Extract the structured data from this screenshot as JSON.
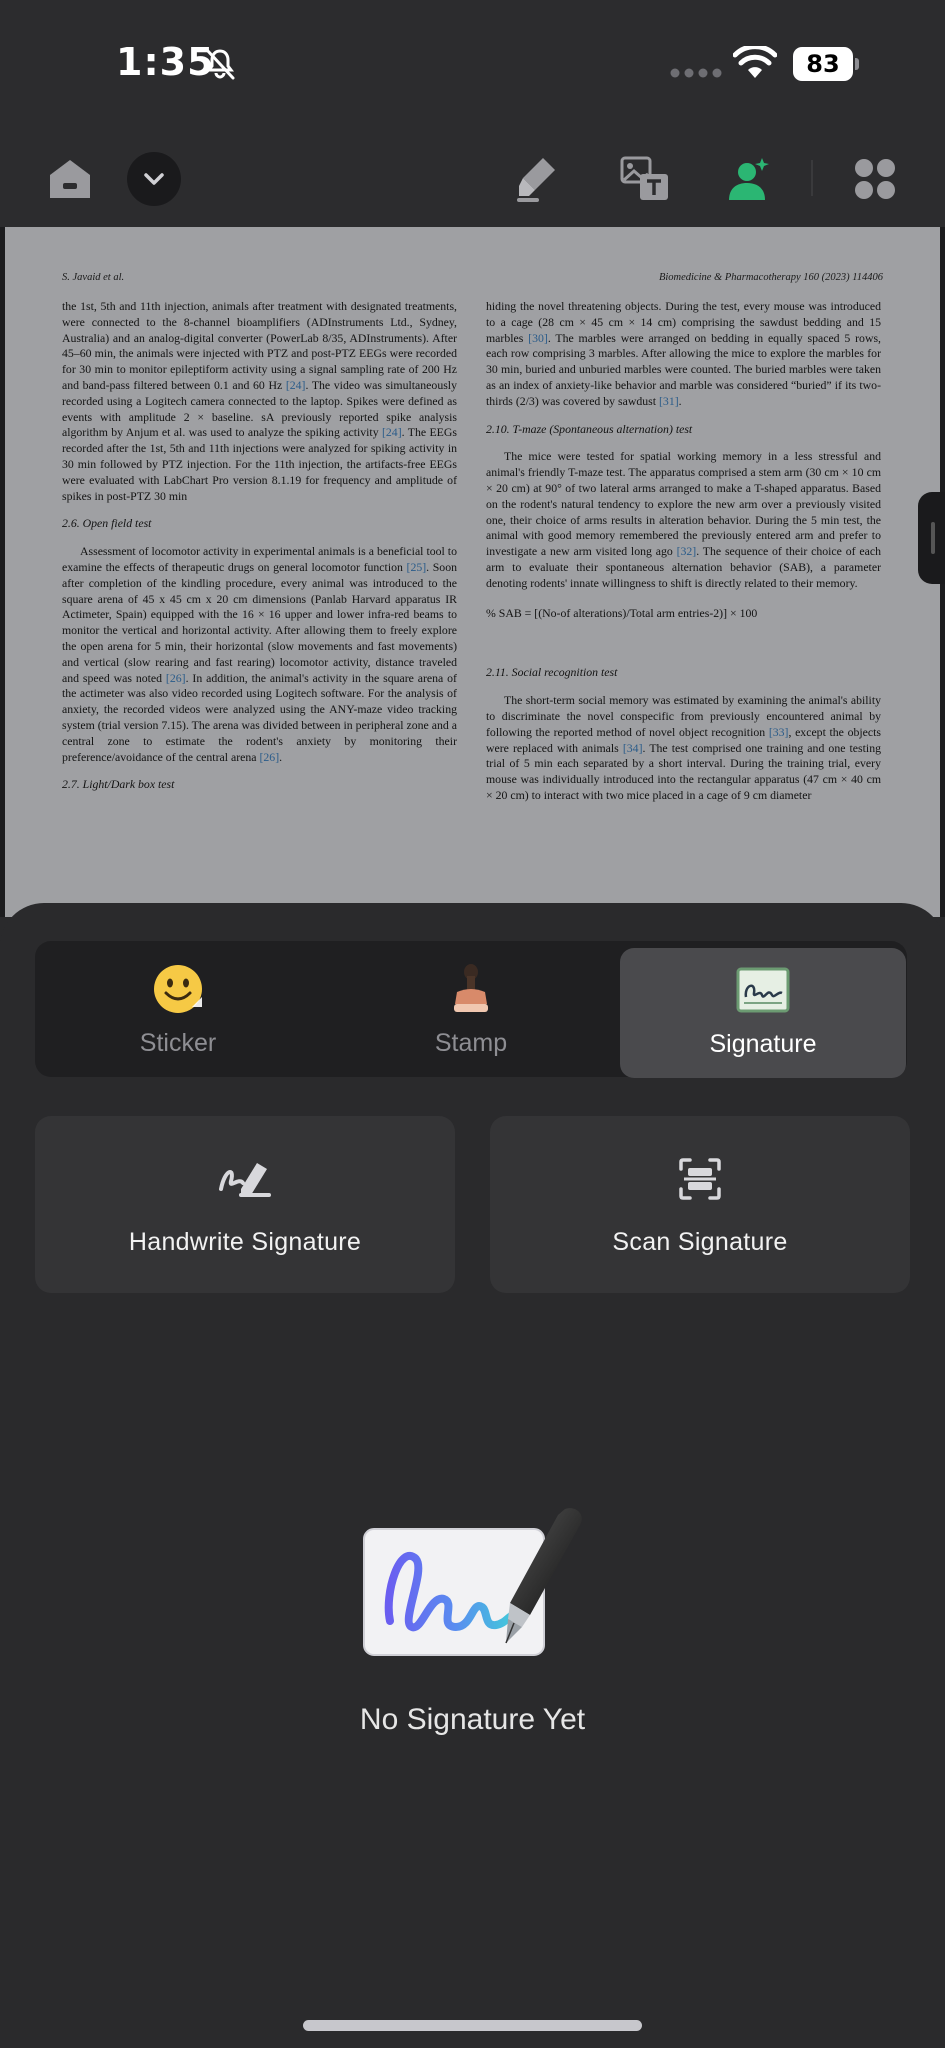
{
  "status_bar": {
    "time": "1:35",
    "battery": "83",
    "icons": [
      "bell-slash-icon",
      "cellular-dots-icon",
      "wifi-icon",
      "battery-icon"
    ]
  },
  "toolbar": {
    "icons": [
      "home-icon",
      "chevron-down-icon",
      "highlighter-icon",
      "image-text-icon",
      "person-add-icon",
      "grid-icon"
    ],
    "accent": "#2bb673"
  },
  "document": {
    "header_left": "S. Javaid et al.",
    "header_right": "Biomedicine & Pharmacotherapy 160 (2023) 114406",
    "left_col": {
      "p1": "the 1st, 5th and 11th injection, animals after treatment with designated treatments, were connected to the 8-channel bioamplifiers (ADInstruments Ltd., Sydney, Australia) and an analog-digital converter (PowerLab 8/35, ADInstruments). After 45–60 min, the animals were injected with PTZ and post-PTZ EEGs were recorded for 30 min to monitor epileptiform activity using a signal sampling rate of 200 Hz and band-pass filtered between 0.1 and 60 Hz ",
      "p1_ref1": "[24]",
      "p1b": ". The video was simultaneously recorded using a Logitech camera connected to the laptop. Spikes were defined as events with amplitude 2 × baseline. sA previously reported spike analysis algorithm by Anjum et al. was used to analyze the spiking activity ",
      "p1_ref2": "[24]",
      "p1c": ". The EEGs recorded after the 1st, 5th and 11th injections were analyzed for spiking activity in 30 min followed by PTZ injection. For the 11th injection, the artifacts-free EEGs were evaluated with LabChart Pro version 8.1.19 for frequency and amplitude of spikes in post-PTZ 30 min",
      "h26": "2.6.  Open field test",
      "p2": "Assessment of locomotor activity in experimental animals is a beneficial tool to examine the effects of therapeutic drugs on general locomotor function ",
      "p2_ref1": "[25]",
      "p2b": ". Soon after completion of the kindling procedure, every animal was introduced to the square arena of 45 x 45 cm x 20 cm dimensions (Panlab Harvard apparatus IR Actimeter, Spain) equipped with the 16 × 16 upper and lower infra-red beams to monitor the vertical and horizontal activity. After allowing them to freely explore the open arena for 5 min, their horizontal (slow movements and fast movements) and vertical (slow rearing and fast rearing) locomotor activity, distance traveled and speed was noted ",
      "p2_ref2": "[26]",
      "p2c": ". In addition, the animal's activity in the square arena of the actimeter was also video recorded using Logitech software. For the analysis of anxiety, the recorded videos were analyzed using the ANY-maze video tracking system (trial version 7.15). The arena was divided between in peripheral zone and a central zone to estimate the rodent's anxiety by monitoring their preference/avoidance of the central arena ",
      "p2_ref3": "[26]",
      "p2d": ".",
      "h27": "2.7.  Light/Dark box test"
    },
    "right_col": {
      "p1": "hiding the novel threatening objects. During the test, every mouse was introduced to a cage (28 cm × 45 cm × 14 cm) comprising the sawdust bedding and 15 marbles ",
      "p1_ref1": "[30]",
      "p1b": ". The marbles were arranged on bedding in equally spaced 5 rows, each row comprising 3 marbles. After allowing the mice to explore the marbles for 30 min, buried and unburied marbles were counted. The buried marbles were taken as an index of anxiety-like behavior and marble was considered “buried” if its two-thirds (2/3) was covered by sawdust ",
      "p1_ref2": "[31]",
      "p1c": ".",
      "h210": "2.10.  T-maze (Spontaneous alternation) test",
      "p2": "The mice were tested for spatial working memory in a less stressful and animal's friendly T-maze test. The apparatus comprised a stem arm (30 cm × 10 cm × 20 cm) at 90° of two lateral arms arranged to make a T-shaped apparatus. Based on the rodent's natural tendency to explore the new arm over a previously visited one, their choice of arms results in alteration behavior. During the 5 min test, the animal with good memory remembered the previously entered arm and prefer to investigate a new arm visited long ago ",
      "p2_ref1": "[32]",
      "p2b": ". The sequence of their choice of each arm to evaluate their spontaneous alternation behavior (SAB), a parameter denoting rodents' innate willingness to shift is directly related to their memory.",
      "formula": "% SAB = [(No-of alterations)/Total arm entries-2)] × 100",
      "h211": "2.11.  Social recognition test",
      "p3": "The short-term social memory was estimated by examining the animal's ability to discriminate the novel conspecific from previously encountered animal by following the reported method of novel object recognition ",
      "p3_ref1": "[33]",
      "p3b": ", except the objects were replaced with animals ",
      "p3_ref2": "[34]",
      "p3c": ". The test comprised one training and one testing trial of 5 min each separated by a short interval. During the training trial, every mouse was individually introduced into the rectangular apparatus (47 cm × 40 cm × 20 cm) to interact with two mice placed in a cage of 9 cm diameter"
    }
  },
  "sheet": {
    "tabs": [
      {
        "label": "Sticker",
        "icon": "smiley-sticker-icon"
      },
      {
        "label": "Stamp",
        "icon": "stamp-icon"
      },
      {
        "label": "Signature",
        "icon": "signature-icon",
        "active": true
      }
    ],
    "actions": [
      {
        "label": "Handwrite Signature",
        "icon": "handwrite-signature-icon"
      },
      {
        "label": "Scan Signature",
        "icon": "scan-signature-icon"
      }
    ],
    "empty_state": {
      "text": "No Signature Yet",
      "illustration": "signature-pen-illustration"
    }
  }
}
